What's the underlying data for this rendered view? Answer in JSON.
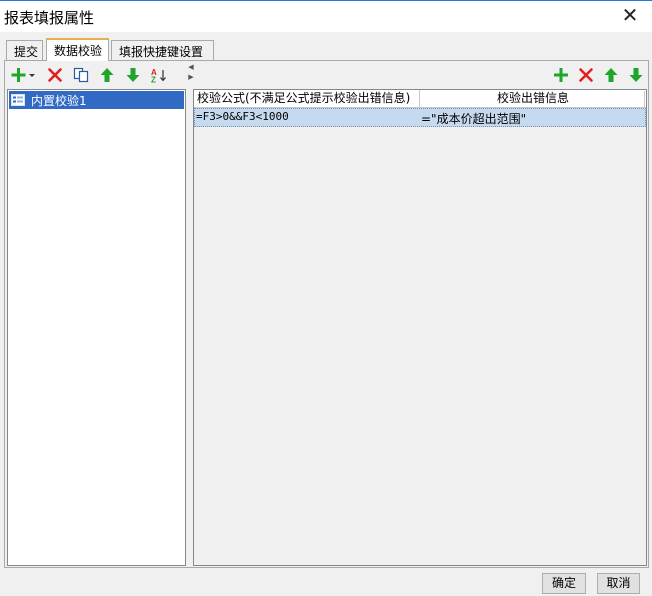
{
  "window": {
    "title": "报表填报属性",
    "close_glyph": "✕"
  },
  "tabs": [
    {
      "label": "提交"
    },
    {
      "label": "数据校验"
    },
    {
      "label": "填报快捷键设置"
    }
  ],
  "left_toolbar": {
    "icons": [
      "add-dropdown-icon",
      "delete-icon",
      "copy-icon",
      "move-up-icon",
      "move-down-icon",
      "sort-icon"
    ]
  },
  "left_list": {
    "items": [
      {
        "label": "内置校验1",
        "icon": "form-icon"
      }
    ]
  },
  "right_toolbar": {
    "icons": [
      "add-icon",
      "delete-icon",
      "move-up-icon",
      "move-down-icon"
    ]
  },
  "grid": {
    "headers": [
      "校验公式(不满足公式提示校验出错信息)",
      "校验出错信息"
    ],
    "rows": [
      {
        "formula": "=F3>0&&F3<1000",
        "message": "=\"成本价超出范围\""
      }
    ]
  },
  "buttons": {
    "ok": "确定",
    "cancel": "取消"
  },
  "colors": {
    "accent_green": "#1fa52a",
    "delete_red": "#e02020",
    "selection_blue": "#316ac5",
    "row_highlight": "#c5d9ef",
    "active_tab_border": "#e3b049"
  }
}
